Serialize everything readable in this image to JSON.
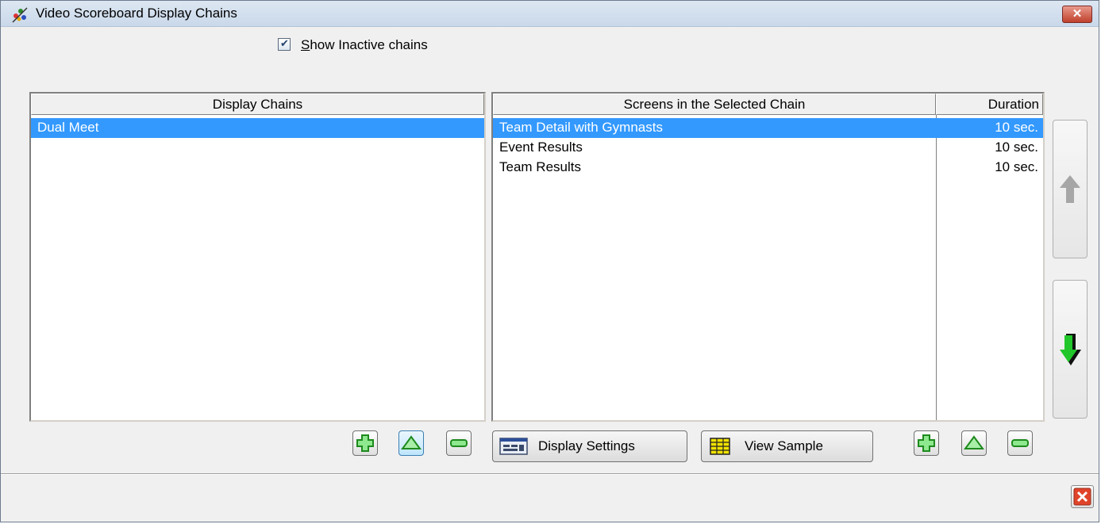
{
  "window": {
    "title": "Video Scoreboard Display Chains",
    "close_glyph": "✕"
  },
  "options": {
    "show_inactive_checked": true,
    "show_inactive_label_first": "S",
    "show_inactive_label_rest": "how Inactive chains"
  },
  "chains": {
    "header": "Display Chains",
    "items": [
      {
        "label": "Dual Meet",
        "selected": true
      }
    ]
  },
  "screens": {
    "header": "Screens in the Selected Chain",
    "duration_header": "Duration",
    "items": [
      {
        "name": "Team Detail with Gymnasts",
        "duration": "10 sec.",
        "selected": true
      },
      {
        "name": "Event Results",
        "duration": "10 sec.",
        "selected": false
      },
      {
        "name": "Team Results",
        "duration": "10 sec.",
        "selected": false
      }
    ]
  },
  "buttons": {
    "display_settings": "Display Settings",
    "view_sample": "View Sample"
  },
  "icons": {
    "app": "gymnast-icon",
    "move_up": "gray-up-arrow-icon",
    "move_down": "green-down-arrow-icon",
    "add": "green-plus-icon",
    "edit": "green-triangle-icon",
    "remove": "green-minus-icon"
  },
  "colors": {
    "selection": "#3399ff",
    "icon_green": "#22c52a"
  }
}
